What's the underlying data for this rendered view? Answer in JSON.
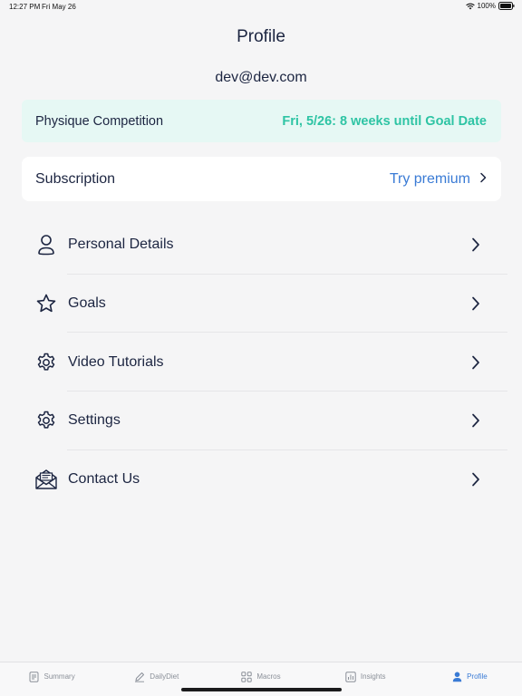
{
  "status_bar": {
    "time": "12:27 PM",
    "date": "Fri May 26",
    "battery": "100%"
  },
  "page": {
    "title": "Profile",
    "email": "dev@dev.com"
  },
  "goal_banner": {
    "name": "Physique Competition",
    "date_text": "Fri, 5/26: 8 weeks until Goal Date"
  },
  "subscription": {
    "label": "Subscription",
    "action": "Try premium"
  },
  "menu": {
    "items": [
      {
        "label": "Personal Details",
        "icon": "person-icon"
      },
      {
        "label": "Goals",
        "icon": "star-icon"
      },
      {
        "label": "Video Tutorials",
        "icon": "gear-icon"
      },
      {
        "label": "Settings",
        "icon": "gear-icon"
      },
      {
        "label": "Contact Us",
        "icon": "mail-icon"
      }
    ]
  },
  "tabs": [
    {
      "label": "Summary",
      "icon": "document-icon",
      "active": false
    },
    {
      "label": "DailyDiet",
      "icon": "pencil-icon",
      "active": false
    },
    {
      "label": "Macros",
      "icon": "grid-icon",
      "active": false
    },
    {
      "label": "Insights",
      "icon": "chart-icon",
      "active": false
    },
    {
      "label": "Profile",
      "icon": "person-icon",
      "active": true
    }
  ],
  "colors": {
    "accent": "#3a7bd5",
    "goal_teal": "#2ec4a4",
    "text_dark": "#1c2541",
    "banner_bg": "#e6f8f4"
  }
}
